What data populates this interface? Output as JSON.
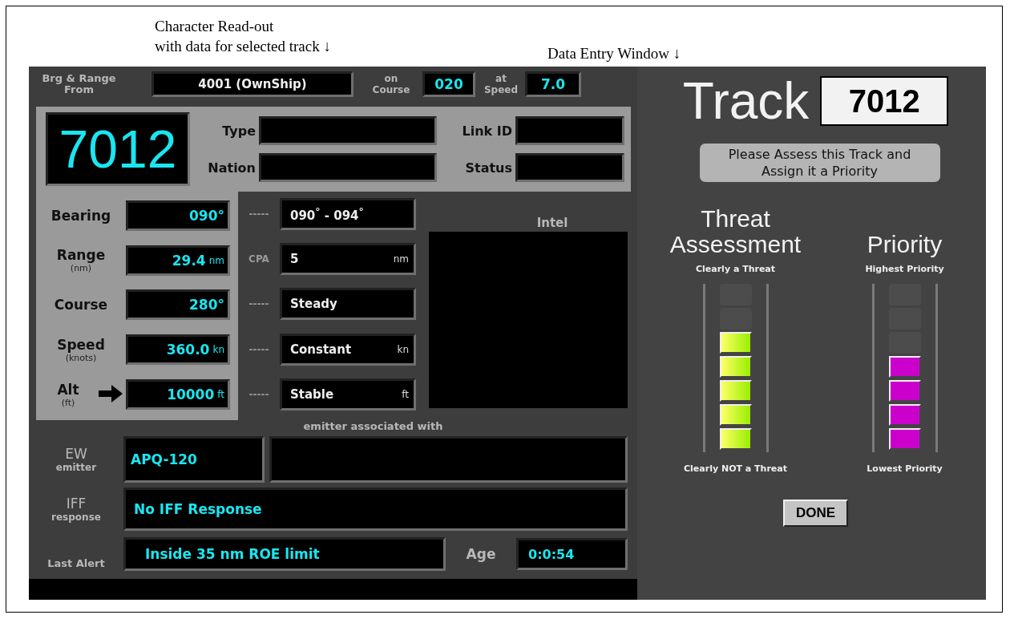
{
  "annotations": {
    "readout_lines": [
      "Character Read-out",
      "with data for selected track  ↓"
    ],
    "entry_label": "Data Entry Window  ↓"
  },
  "readout": {
    "origin_label": "Brg & Range From",
    "origin": "4001 (OwnShip)",
    "course_label": "on Course",
    "course": "020",
    "speed_label": "at Speed",
    "speed": "7.0",
    "track_number": "7012",
    "info_fields": [
      {
        "label": "Type"
      },
      {
        "label": "Link ID"
      },
      {
        "label": "Nation"
      },
      {
        "label": "Status"
      }
    ],
    "kinematics": [
      {
        "label": "Bearing",
        "value": "090°",
        "pointer": false,
        "trend_label": "-----",
        "trend": "090$^{°}$ - 094$^{°}$"
      },
      {
        "label": "Range",
        "sublabel": "(nm)",
        "value": "29.4",
        "unit": "nm",
        "pointer": false,
        "trend_label": "CPA",
        "trend": "5",
        "trend_unit": "nm"
      },
      {
        "label": "Course",
        "value": "280°",
        "pointer": false,
        "trend_label": "-----",
        "trend": "Steady"
      },
      {
        "label": "Speed",
        "sublabel": "(knots)",
        "value": "360.0",
        "unit": "kn",
        "pointer": false,
        "trend_label": "-----",
        "trend": "Constant",
        "trend_unit": "kn"
      },
      {
        "label": "Alt",
        "sublabel": "(ft)",
        "value": "10000",
        "unit": "ft",
        "pointer": true,
        "trend_label": "-----",
        "trend": "Stable",
        "trend_unit": "ft"
      }
    ],
    "intel_label": "Intel",
    "emitter_caption": "emitter associated with",
    "ew": {
      "label": "EW",
      "sublabel": "emitter",
      "value": "APQ-120"
    },
    "iff": {
      "label": "IFF",
      "sublabel": "response",
      "value": "No IFF Response"
    },
    "last_alert": {
      "label": "Last Alert",
      "value": "Inside 35 nm ROE limit",
      "age_label": "Age",
      "age": "0:0:54"
    }
  },
  "data_entry": {
    "title": "Track",
    "track_number": "7012",
    "prompt": "Please Assess this Track and Assign it a Priority",
    "scales": [
      {
        "kind": "threat",
        "title": "Threat Assessment",
        "top_label": "Clearly a Threat",
        "bottom_label": "Clearly NOT a Threat",
        "segments": [
          {
            "lit": false
          },
          {
            "lit": false
          },
          {
            "lit": true
          },
          {
            "lit": true
          },
          {
            "lit": true
          },
          {
            "lit": true
          },
          {
            "lit": true
          }
        ]
      },
      {
        "kind": "priority",
        "title": "Priority",
        "top_label": "Highest Priority",
        "bottom_label": "Lowest Priority",
        "segments": [
          {
            "lit": false
          },
          {
            "lit": false
          },
          {
            "lit": false
          },
          {
            "lit": true
          },
          {
            "lit": true
          },
          {
            "lit": true
          },
          {
            "lit": true
          }
        ]
      }
    ],
    "done_button": "DONE"
  }
}
